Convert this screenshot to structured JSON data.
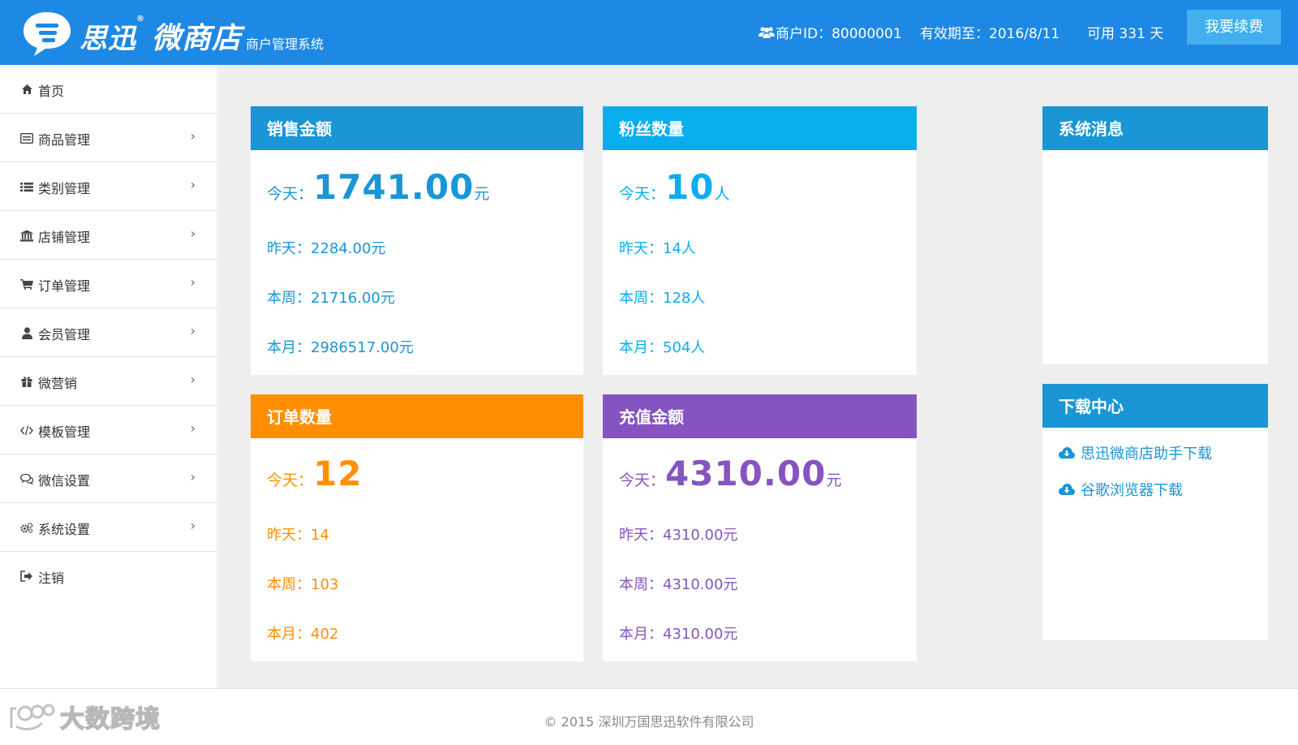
{
  "header": {
    "brand_main": "思迅",
    "brand_reg": "®",
    "brand_product": "微商店",
    "brand_sub": "商户管理系统",
    "merchant_id": "商户ID：80000001",
    "expiry": "有效期至：2016/8/11",
    "remaining": "可用 331 天",
    "renew_button": "我要续费"
  },
  "sidebar": {
    "items": [
      {
        "label": "首页",
        "icon": "home-icon"
      },
      {
        "label": "商品管理",
        "icon": "product-icon"
      },
      {
        "label": "类别管理",
        "icon": "list-icon"
      },
      {
        "label": "店铺管理",
        "icon": "bank-icon"
      },
      {
        "label": "订单管理",
        "icon": "cart-icon"
      },
      {
        "label": "会员管理",
        "icon": "user-icon"
      },
      {
        "label": "微营销",
        "icon": "gift-icon"
      },
      {
        "label": "模板管理",
        "icon": "code-icon"
      },
      {
        "label": "微信设置",
        "icon": "chat-icon"
      },
      {
        "label": "系统设置",
        "icon": "gears-icon"
      },
      {
        "label": "注销",
        "icon": "logout-icon"
      }
    ],
    "chevron": "›"
  },
  "sales": {
    "title": "销售金额",
    "today_label": "今天：",
    "today_value": "1741.00",
    "today_unit": "元",
    "yesterday": "昨天：2284.00元",
    "week": "本周：21716.00元",
    "month": "本月：2986517.00元"
  },
  "fans": {
    "title": "粉丝数量",
    "today_label": "今天：",
    "today_value": "10",
    "today_unit": "人",
    "yesterday": "昨天：14人",
    "week": "本周：128人",
    "month": "本月：504人"
  },
  "orders": {
    "title": "订单数量",
    "today_label": "今天：",
    "today_value": "12",
    "today_unit": "",
    "yesterday": "昨天：14",
    "week": "本周：103",
    "month": "本月：402"
  },
  "recharge": {
    "title": "充值金额",
    "today_label": "今天：",
    "today_value": "4310.00",
    "today_unit": "元",
    "yesterday": "昨天：4310.00元",
    "week": "本周：4310.00元",
    "month": "本月：4310.00元"
  },
  "messages": {
    "title": "系统消息"
  },
  "downloads": {
    "title": "下载中心",
    "items": [
      "思迅微商店助手下载",
      "谷歌浏览器下载"
    ]
  },
  "footer": {
    "copyright": "© 2015 深圳万国思迅软件有限公司",
    "watermark": "大数跨境"
  },
  "colors": {
    "header": "#1e88e5",
    "sales": "#1a95d6",
    "fans": "#09aeef",
    "orders": "#ff8f00",
    "recharge": "#8554c1"
  }
}
